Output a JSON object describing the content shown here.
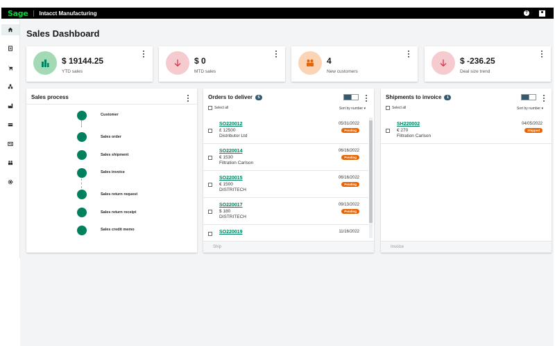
{
  "app": {
    "brand": "Sage",
    "product": "Intacct Manufacturing"
  },
  "header": {
    "help_icon": "help-icon",
    "user_icon": "user-icon"
  },
  "sidebar": {
    "items": [
      {
        "icon": "home-icon",
        "active": true
      },
      {
        "icon": "list-icon"
      },
      {
        "icon": "cart-icon"
      },
      {
        "icon": "hierarchy-icon"
      },
      {
        "icon": "factory-icon"
      },
      {
        "icon": "card-icon"
      },
      {
        "icon": "contact-card-icon"
      },
      {
        "icon": "people-icon"
      },
      {
        "icon": "gear-icon"
      }
    ]
  },
  "page": {
    "title": "Sales Dashboard"
  },
  "kpis": [
    {
      "value": "$ 19144.25",
      "label": "YTD sales",
      "icon": "bar-chart-icon",
      "color": "#a3d9b5",
      "icon_color": "#00815d"
    },
    {
      "value": "$ 0",
      "label": "MTD sales",
      "icon": "arrow-down-icon",
      "color": "#f6cbd0",
      "icon_color": "#d4384d"
    },
    {
      "value": "4",
      "label": "New customers",
      "icon": "people-icon",
      "color": "#fbd3b5",
      "icon_color": "#e96400"
    },
    {
      "value": "$ -236.25",
      "label": "Deal size trend",
      "icon": "arrow-down-icon",
      "color": "#f6cbd0",
      "icon_color": "#d4384d"
    }
  ],
  "sales_process": {
    "title": "Sales process",
    "steps": [
      "Customer",
      "Sales order",
      "Sales shipment",
      "Sales invoice",
      "Sales return request",
      "Sales return receipt",
      "Sales credit memo"
    ]
  },
  "orders": {
    "title": "Orders to deliver",
    "count": "5",
    "select_all": "Select all",
    "sort": "Sort by number",
    "footer_action": "Ship",
    "rows": [
      {
        "doc": "SO220012",
        "amount": "£ 12500",
        "customer": "Distributor Ltd",
        "date": "05/31/2022",
        "status": "Pending"
      },
      {
        "doc": "SO220014",
        "amount": "€ 1530",
        "customer": "Filtration Carlson",
        "date": "06/16/2022",
        "status": "Pending"
      },
      {
        "doc": "SO220015",
        "amount": "€ 1500",
        "customer": "DISTRITECH",
        "date": "06/16/2022",
        "status": "Pending"
      },
      {
        "doc": "SO220017",
        "amount": "$ 180",
        "customer": "DISTRITECH",
        "date": "09/13/2022",
        "status": "Pending"
      },
      {
        "doc": "SO220019",
        "amount": "",
        "customer": "",
        "date": "11/16/2022",
        "status": ""
      }
    ]
  },
  "shipments": {
    "title": "Shipments to invoice",
    "count": "1",
    "select_all": "Select all",
    "sort": "Sort by number",
    "footer_action": "Invoice",
    "rows": [
      {
        "doc": "SH220002",
        "amount": "€ 270",
        "customer": "Filtration Carlson",
        "date": "04/05/2022",
        "status": "Shipped"
      }
    ]
  },
  "colors": {
    "accent_green": "#00815d",
    "brand_green": "#00d639",
    "status_orange": "#e96400",
    "badge_navy": "#335b6d"
  }
}
